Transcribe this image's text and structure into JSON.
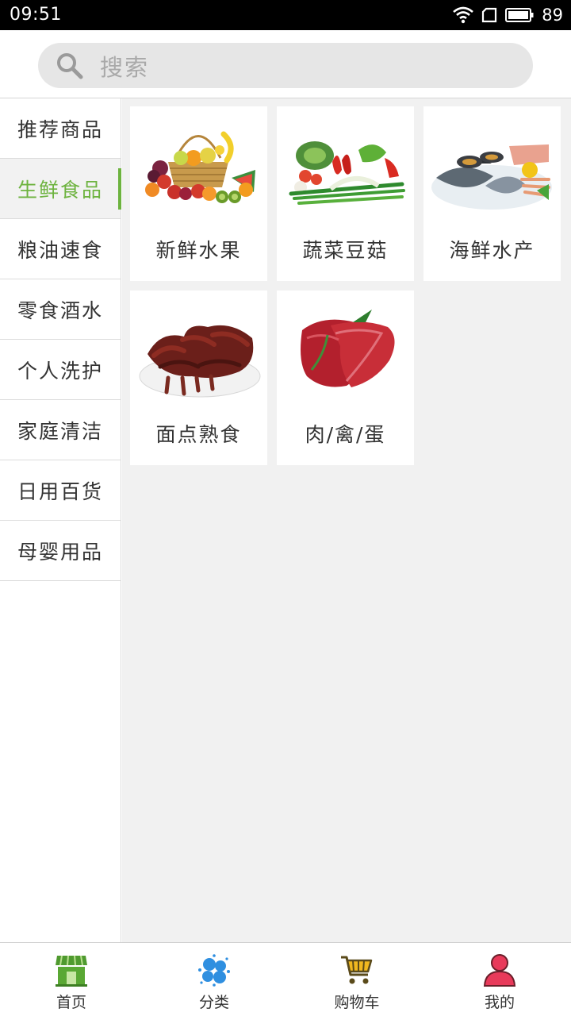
{
  "status": {
    "time": "09:51",
    "battery": "89"
  },
  "search": {
    "placeholder": "搜索"
  },
  "sidebar": {
    "items": [
      {
        "label": "推荐商品"
      },
      {
        "label": "生鲜食品",
        "active": true
      },
      {
        "label": "粮油速食"
      },
      {
        "label": "零食酒水"
      },
      {
        "label": "个人洗护"
      },
      {
        "label": "家庭清洁"
      },
      {
        "label": "日用百货"
      },
      {
        "label": "母婴用品"
      }
    ]
  },
  "categories": [
    {
      "label": "新鲜水果",
      "icon": "fruit-basket-image"
    },
    {
      "label": "蔬菜豆菇",
      "icon": "vegetables-image"
    },
    {
      "label": "海鲜水产",
      "icon": "seafood-image"
    },
    {
      "label": "面点熟食",
      "icon": "braised-duck-image"
    },
    {
      "label": "肉/禽/蛋",
      "icon": "raw-meat-image"
    }
  ],
  "bottom_nav": [
    {
      "label": "首页",
      "icon": "storefront-icon"
    },
    {
      "label": "分类",
      "icon": "category-icon"
    },
    {
      "label": "购物车",
      "icon": "cart-icon"
    },
    {
      "label": "我的",
      "icon": "user-icon"
    }
  ],
  "colors": {
    "accent": "#6db33f",
    "search_bg": "#e6e6e6",
    "content_bg": "#f1f1f1"
  }
}
